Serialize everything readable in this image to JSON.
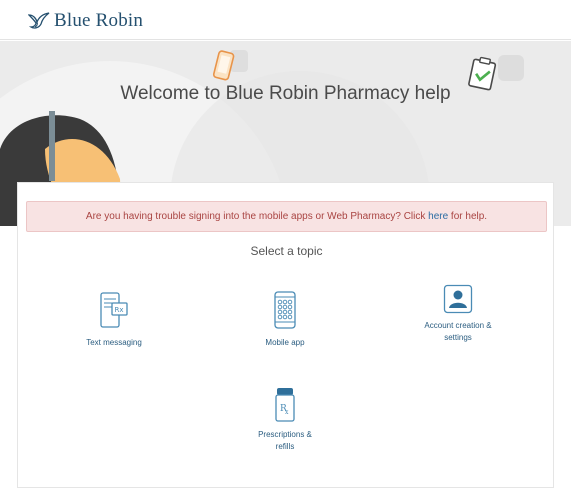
{
  "header": {
    "logo_text": "Blue Robin"
  },
  "hero": {
    "title": "Welcome to Blue Robin Pharmacy help"
  },
  "alert": {
    "text_before": "Are you having trouble signing into the mobile apps or Web Pharmacy? Click ",
    "link_text": "here",
    "text_after": " for help."
  },
  "topics": {
    "heading": "Select a topic",
    "items": [
      {
        "label": "Text messaging",
        "icon": "text-messaging-icon"
      },
      {
        "label": "Mobile app",
        "icon": "mobile-app-icon"
      },
      {
        "label": "Account creation & settings",
        "icon": "account-icon"
      },
      {
        "label": "Prescriptions & refills",
        "icon": "prescription-bottle-icon"
      }
    ]
  },
  "colors": {
    "brand": "#25506f",
    "link": "#2b5d80",
    "alert_bg": "#f8e3e3",
    "alert_text": "#a94442",
    "hero_bg": "#ebebeb"
  }
}
